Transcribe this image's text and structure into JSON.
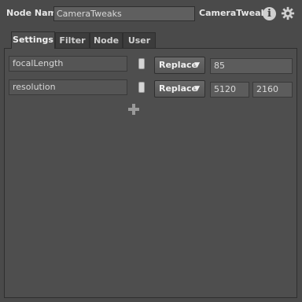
{
  "header": {
    "node_name_label": "Node Name",
    "node_name_value": "CameraTweaks",
    "node_type": "CameraTweaks"
  },
  "tabs": [
    {
      "label": "Settings",
      "active": true
    },
    {
      "label": "Filter",
      "active": false
    },
    {
      "label": "Node",
      "active": false
    },
    {
      "label": "User",
      "active": false
    }
  ],
  "params": [
    {
      "name": "focalLength",
      "mode": "Replace",
      "values": [
        "85"
      ]
    },
    {
      "name": "resolution",
      "mode": "Replace",
      "values": [
        "5120",
        "2160"
      ]
    }
  ],
  "icons": {
    "info": "info-icon",
    "gear": "gear-icon",
    "add": "plus-icon",
    "lock": "lock-toggle-icon",
    "dropdown": "chevron-down-icon"
  },
  "colors": {
    "background": "#4a4a4a",
    "panel": "#4e4e4e",
    "field": "#5c5c5c",
    "text": "#d8d8d8"
  }
}
